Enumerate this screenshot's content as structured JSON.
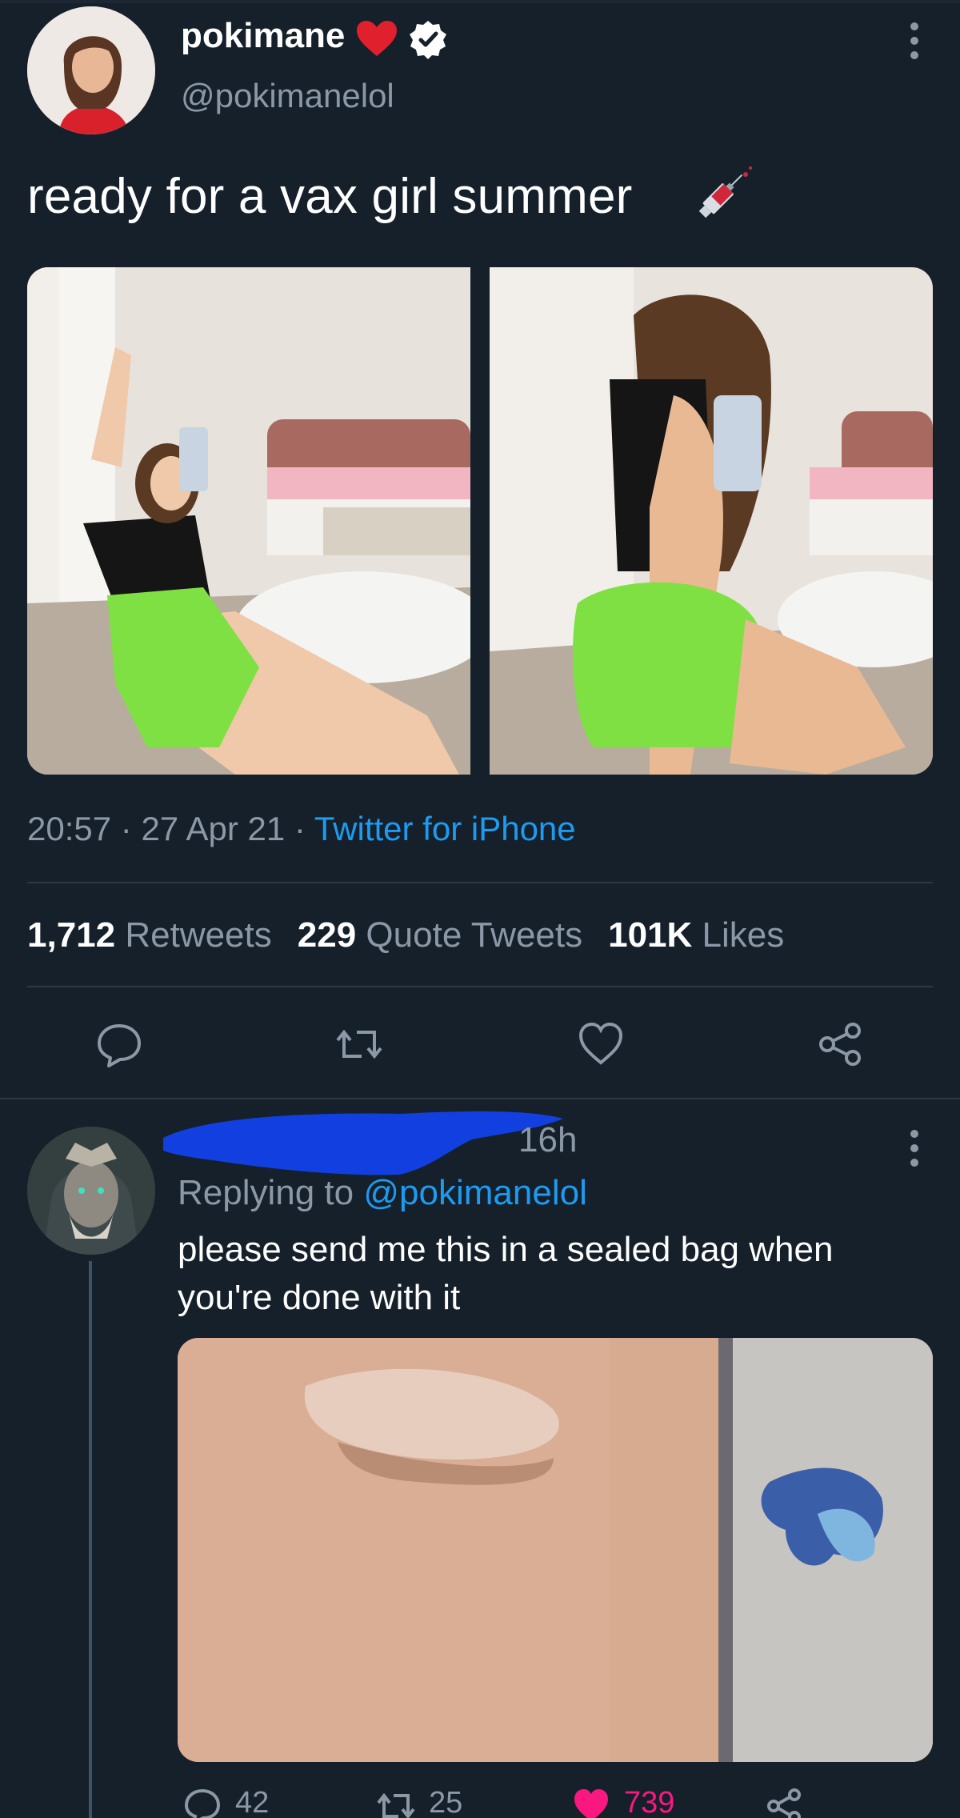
{
  "tweet": {
    "author_name": "pokimane",
    "author_handle": "@pokimanelol",
    "text": "ready for a vax girl summer",
    "time": "20:57",
    "date": "27 Apr 21",
    "source": "Twitter for iPhone",
    "stats": {
      "retweets_count": "1,712",
      "retweets_label": "Retweets",
      "quotes_count": "229",
      "quotes_label": "Quote Tweets",
      "likes_count": "101K",
      "likes_label": "Likes"
    },
    "icons": [
      "red-heart-emoji",
      "verified-badge",
      "syringe-emoji",
      "more-icon",
      "reply-icon",
      "retweet-icon",
      "like-icon",
      "share-icon"
    ]
  },
  "reply": {
    "time": "16h",
    "replying_prefix": "Replying to",
    "replying_to": "@pokimanelol",
    "text": "please send me this in a sealed bag when you're done with it",
    "actions": {
      "replies": "42",
      "retweets": "25",
      "likes": "739"
    }
  },
  "colors": {
    "background": "#15202b",
    "text_primary": "#ffffff",
    "text_secondary": "#8b98a5",
    "accent_blue": "#1d9bf0",
    "like_pink": "#f91880",
    "divider": "#2b3945",
    "redaction_blue": "#1240e0"
  }
}
